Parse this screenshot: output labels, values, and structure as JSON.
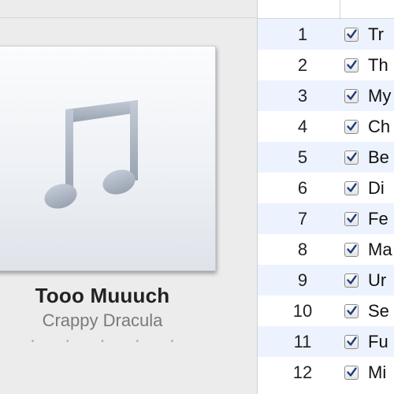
{
  "album": {
    "title": "Tooo Muuuch",
    "artist": "Crappy Dracula",
    "rating_dots": "• • • • •",
    "artwork_icon": "music-note-icon"
  },
  "tracks": [
    {
      "number": "1",
      "title": "Tr",
      "checked": true
    },
    {
      "number": "2",
      "title": "Th",
      "checked": true
    },
    {
      "number": "3",
      "title": "My",
      "checked": true
    },
    {
      "number": "4",
      "title": "Ch",
      "checked": true
    },
    {
      "number": "5",
      "title": "Be",
      "checked": true
    },
    {
      "number": "6",
      "title": "Di",
      "checked": true
    },
    {
      "number": "7",
      "title": "Fe",
      "checked": true
    },
    {
      "number": "8",
      "title": "Ma",
      "checked": true
    },
    {
      "number": "9",
      "title": "Ur",
      "checked": true
    },
    {
      "number": "10",
      "title": "Se",
      "checked": true
    },
    {
      "number": "11",
      "title": "Fu",
      "checked": true
    },
    {
      "number": "12",
      "title": "Mi",
      "checked": true
    }
  ]
}
